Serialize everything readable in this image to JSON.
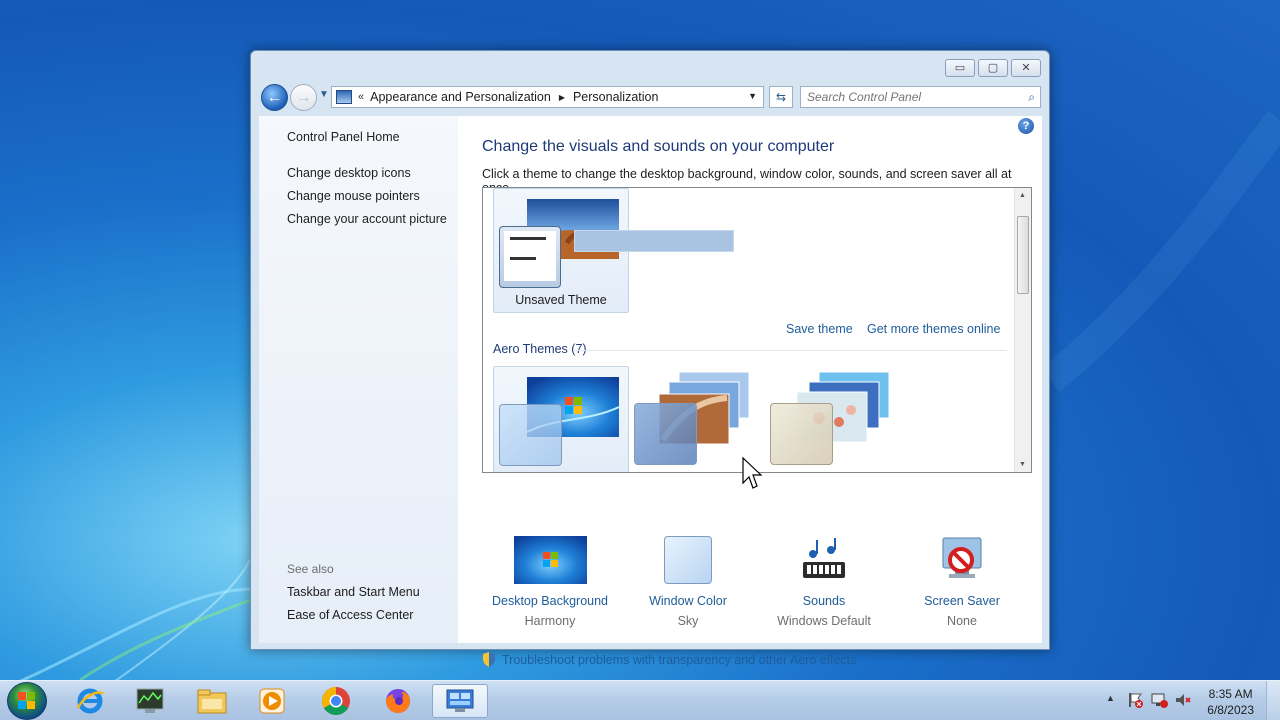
{
  "window": {
    "address": {
      "chevron": "«",
      "crumbs": [
        "Appearance and Personalization",
        "Personalization"
      ]
    },
    "search_placeholder": "Search Control Panel",
    "minimize_glyph": "▭",
    "maximize_glyph": "▢",
    "close_glyph": "✕"
  },
  "left_pane": {
    "home": "Control Panel Home",
    "links": [
      "Change desktop icons",
      "Change mouse pointers",
      "Change your account picture"
    ],
    "see_also": "See also",
    "see_also_links": [
      "Taskbar and Start Menu",
      "Ease of Access Center"
    ]
  },
  "main": {
    "title": "Change the visuals and sounds on your computer",
    "subtitle": "Click a theme to change the desktop background, window color, sounds, and screen saver all at once.",
    "my_theme": {
      "label": "Unsaved Theme"
    },
    "save_theme": "Save theme",
    "get_more": "Get more themes online",
    "aero_header": "Aero Themes (7)",
    "bottom_items": [
      {
        "label": "Desktop Background",
        "value": "Harmony",
        "icon": "desktop-background-icon"
      },
      {
        "label": "Window Color",
        "value": "Sky",
        "icon": "window-color-icon"
      },
      {
        "label": "Sounds",
        "value": "Windows Default",
        "icon": "sounds-icon"
      },
      {
        "label": "Screen Saver",
        "value": "None",
        "icon": "screen-saver-icon"
      }
    ],
    "troubleshoot": "Troubleshoot problems with transparency and other Aero effects"
  },
  "taskbar": {
    "apps": [
      "internet-explorer-icon",
      "task-manager-icon",
      "file-explorer-icon",
      "media-player-icon",
      "chrome-icon",
      "firefox-icon",
      "control-panel-icon"
    ],
    "time": "8:35 AM",
    "date": "6/8/2023"
  },
  "colors": {
    "link": "#1e5c9a",
    "title": "#1e3a78",
    "desktop": "#1a6fc9"
  }
}
